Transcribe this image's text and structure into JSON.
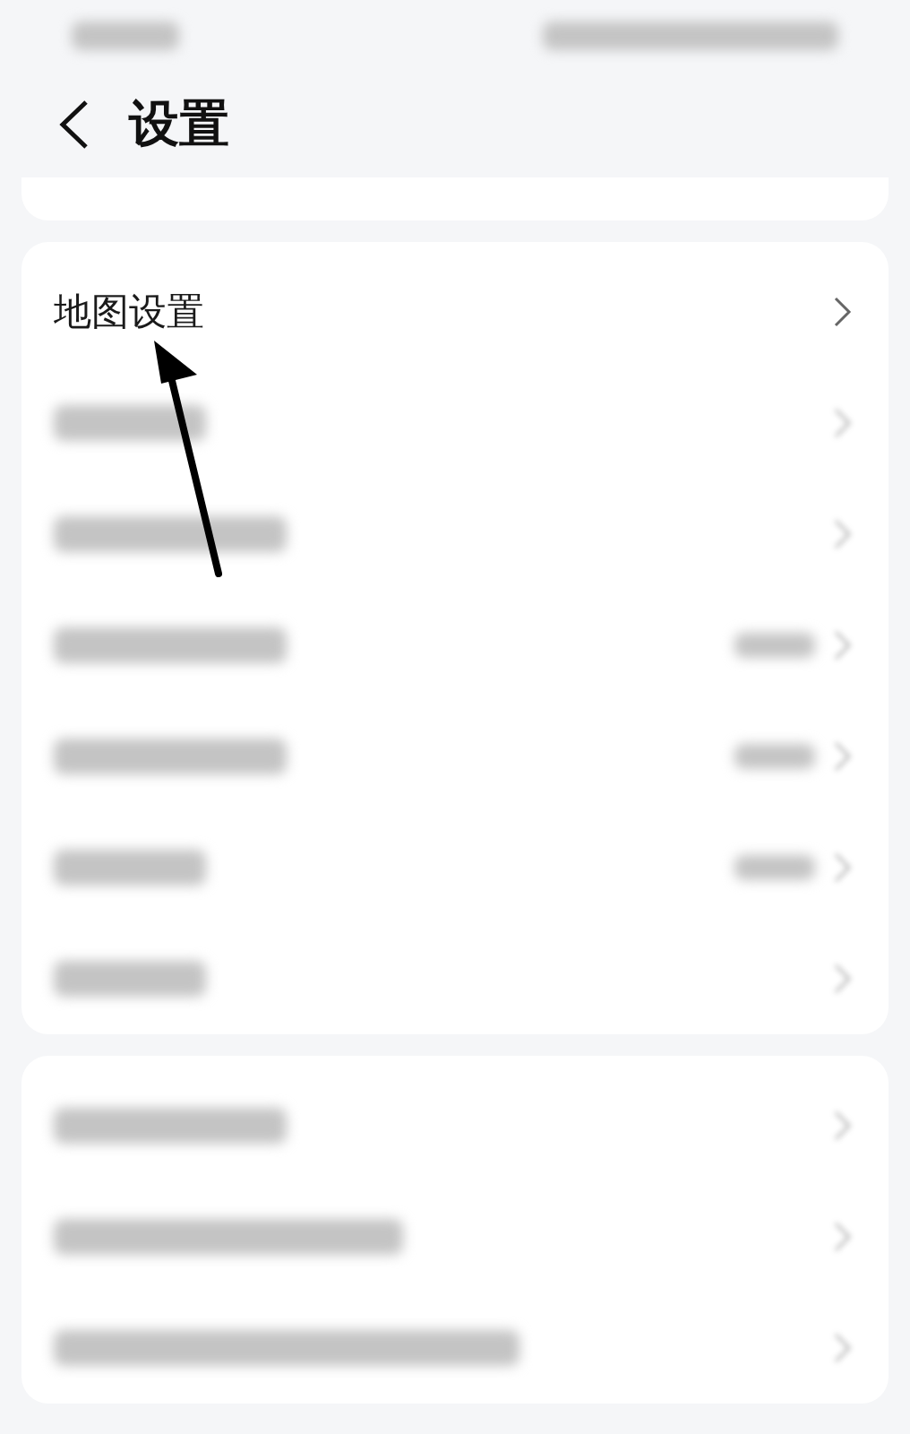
{
  "header": {
    "title": "设置"
  },
  "cards": [
    {
      "kind": "cut"
    },
    {
      "kind": "full",
      "rows": [
        {
          "kind": "text",
          "label": "地图设置"
        },
        {
          "kind": "blurred"
        },
        {
          "kind": "blurred"
        },
        {
          "kind": "blurred_with_value"
        },
        {
          "kind": "blurred_with_value"
        },
        {
          "kind": "blurred_with_value"
        },
        {
          "kind": "blurred"
        }
      ]
    },
    {
      "kind": "full",
      "rows": [
        {
          "kind": "blurred"
        },
        {
          "kind": "blurred"
        },
        {
          "kind": "blurred"
        }
      ]
    }
  ],
  "annotation": {
    "kind": "arrow"
  }
}
